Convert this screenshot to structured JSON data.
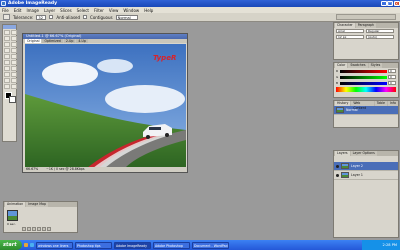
{
  "window": {
    "title": "Adobe ImageReady"
  },
  "menu": [
    "File",
    "Edit",
    "Image",
    "Layer",
    "Slices",
    "Select",
    "Filter",
    "View",
    "Window",
    "Help"
  ],
  "options": {
    "tolerance_label": "Tolerance:",
    "tolerance_value": "32",
    "antialias_label": "Anti-aliased",
    "contiguous_label": "Contiguous",
    "blend_value": "Normal"
  },
  "document": {
    "title": "Untitled-1 @ 66.67% (Original)",
    "tabs": [
      "Original",
      "Optimized",
      "2-Up",
      "4-Up"
    ],
    "logo_text": "TypeR",
    "status_zoom": "66.67%",
    "status_size": "~1K / 0 sec @ 28.8Kbps"
  },
  "animation": {
    "tabs": [
      "Animation",
      "Image Map"
    ],
    "frame_number": "1",
    "frame_delay": "0 sec.",
    "loop": "Forever"
  },
  "panels": {
    "character": {
      "tabs": [
        "Character",
        "Paragraph"
      ],
      "font": "Arial",
      "style": "Regular",
      "size": "12 px",
      "leading": "(Auto)"
    },
    "color": {
      "tabs": [
        "Color",
        "Swatches",
        "Styles"
      ],
      "r": "0",
      "g": "0",
      "b": "0"
    },
    "history": {
      "tabs": [
        "History",
        "Web Content",
        "Table",
        "Info"
      ],
      "item": "Normal"
    },
    "layers": {
      "tabs": [
        "Layers",
        "Layer Options"
      ],
      "items": [
        "Layer 2",
        "Layer 1"
      ]
    }
  },
  "taskbar": {
    "start_label": "start",
    "tasks": [
      "windows one liners",
      "Photoshop tips",
      "Adobe ImageReady",
      "Adobe Photoshop",
      "Document - WordPad"
    ],
    "clock": "2:28 PM"
  },
  "colors": {
    "titlebar": "#1847b8",
    "taskbar": "#2458d8",
    "start": "#2d8b2d",
    "selection": "#4a6eb8",
    "canvas_sky": "#4a7fc9",
    "canvas_grass": "#3b7a2c",
    "car": "#f2f3f5",
    "logo_red": "#d8222a"
  },
  "icons": [
    "photoshop-app-icon",
    "minimize-icon",
    "maximize-icon",
    "close-icon",
    "magic-wand-icon",
    "eye-icon",
    "play-icon",
    "stop-icon",
    "next-frame-icon",
    "prev-frame-icon",
    "new-frame-icon",
    "trash-icon",
    "windows-logo-icon"
  ]
}
